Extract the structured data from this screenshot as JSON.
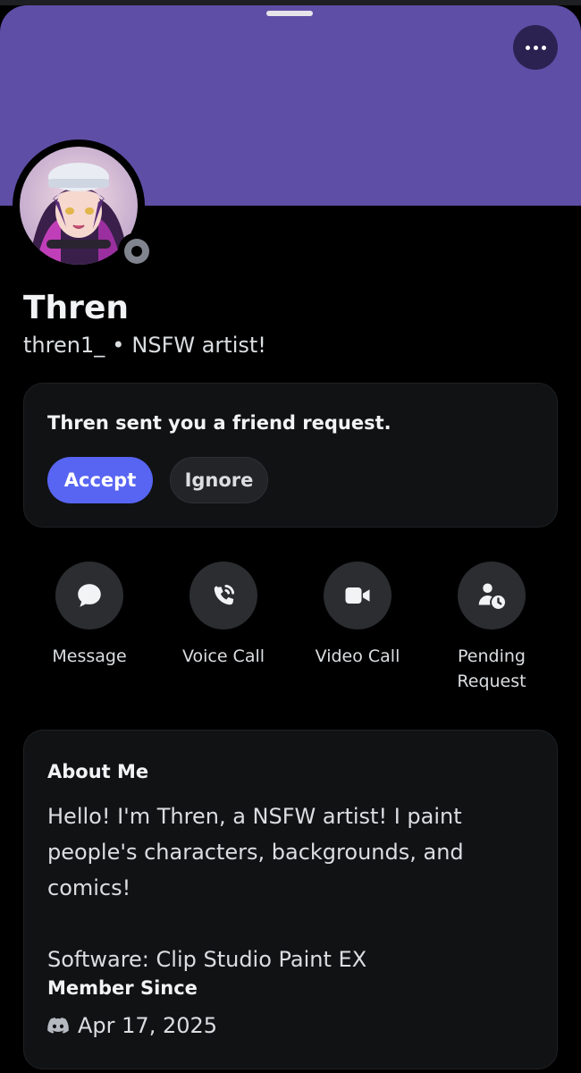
{
  "colors": {
    "banner": "#5f4ea6",
    "accent": "#5865f2",
    "card_background": "#111214",
    "status_offline": "#80848e"
  },
  "profile": {
    "display_name": "Thren",
    "username": "thren1_",
    "separator": "•",
    "pronoun_tag": "NSFW artist!",
    "status": "offline"
  },
  "friend_request": {
    "message": "Thren sent you a friend request.",
    "accept_label": "Accept",
    "ignore_label": "Ignore"
  },
  "actions": [
    {
      "label": "Message",
      "icon": "chat-bubble-icon"
    },
    {
      "label": "Voice Call",
      "icon": "phone-call-icon"
    },
    {
      "label": "Video Call",
      "icon": "video-camera-icon"
    },
    {
      "label": "Pending\nRequest",
      "icon": "pending-user-icon"
    }
  ],
  "about": {
    "title": "About Me",
    "bio_line1": "Hello! I'm Thren, a NSFW artist! I paint people's characters, backgrounds, and comics!",
    "bio_line2": "Software: Clip Studio Paint EX",
    "member_since_title": "Member Since",
    "member_since_date": "Apr 17, 2025",
    "member_icon": "discord-logo-icon"
  }
}
